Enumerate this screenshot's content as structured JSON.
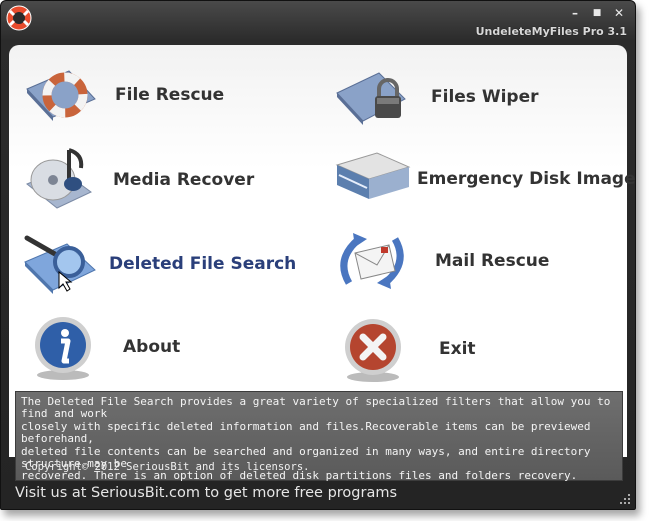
{
  "window": {
    "title": "UndeleteMyFiles Pro 3.1",
    "controls": {
      "minimize": "–",
      "maximize": "■",
      "close": "✕"
    }
  },
  "tiles": [
    {
      "id": "file-rescue",
      "label": "File Rescue",
      "icon": "lifebuoy-folder-icon"
    },
    {
      "id": "files-wiper",
      "label": "Files Wiper",
      "icon": "padlock-folder-icon"
    },
    {
      "id": "media-recover",
      "label": "Media Recover",
      "icon": "music-disc-icon"
    },
    {
      "id": "emergency-disk-image",
      "label": "Emergency Disk Image",
      "icon": "hard-disk-icon"
    },
    {
      "id": "deleted-file-search",
      "label": "Deleted File Search",
      "icon": "magnifier-folder-icon"
    },
    {
      "id": "mail-rescue",
      "label": "Mail Rescue",
      "icon": "mail-arrows-icon"
    },
    {
      "id": "about",
      "label": "About",
      "icon": "info-icon"
    },
    {
      "id": "exit",
      "label": "Exit",
      "icon": "x-circle-icon"
    }
  ],
  "description": {
    "lines": [
      "The Deleted File Search provides a great variety of specialized filters that allow you to find and work",
      "closely with specific deleted information and files.Recoverable items can be previewed beforehand,",
      "deleted file contents can be searched and organized in many ways, and entire directory structure may be",
      "recovered. There is an option of deleted disk partitions files and folders recovery."
    ],
    "copyright": "Copyright© 2012 SeriousBit and its licensors."
  },
  "status": {
    "text": "Visit us at SeriousBit.com to get more free programs"
  },
  "colors": {
    "window_bg": "#2b2b2b",
    "content_bg": "#ffffff",
    "desc_bg": "#666666",
    "label": "#333333",
    "active_label": "#2a3f7a"
  }
}
